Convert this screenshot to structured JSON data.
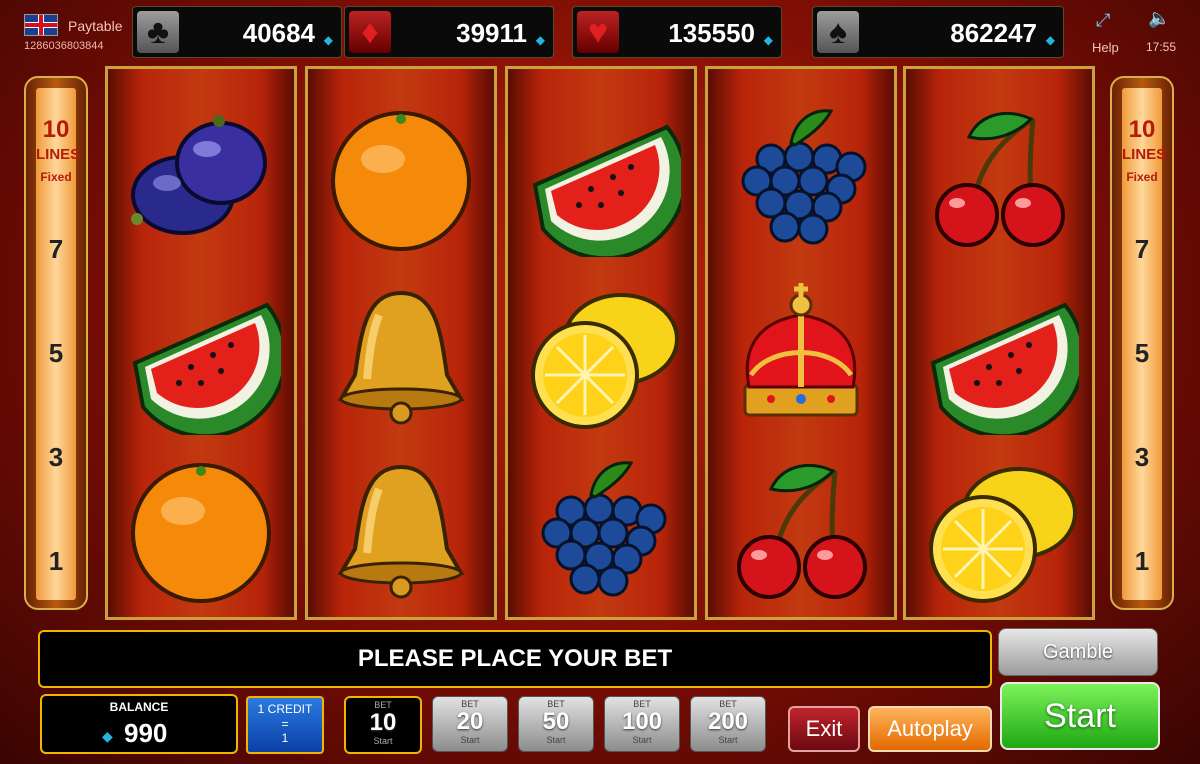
{
  "header": {
    "paytable_label": "Paytable",
    "ticket_id": "1286036803844",
    "help_label": "Help",
    "clock": "17:55",
    "flag_icon": "uk-flag-icon",
    "fullscreen_icon": "fullscreen-icon",
    "sound_icon": "speaker-icon"
  },
  "jackpots": [
    {
      "suit": "clubs",
      "symbol": "♣",
      "value": "40684"
    },
    {
      "suit": "diamonds",
      "symbol": "♦",
      "value": "39911"
    },
    {
      "suit": "hearts",
      "symbol": "♥",
      "value": "135550"
    },
    {
      "suit": "spades",
      "symbol": "♠",
      "value": "862247"
    }
  ],
  "lines_panel": {
    "count": "10",
    "word": "LINES",
    "fixed": "Fixed",
    "markers": [
      "7",
      "5",
      "3",
      "1"
    ]
  },
  "reels": [
    [
      "plum",
      "watermelon",
      "orange"
    ],
    [
      "orange",
      "bell",
      "bell"
    ],
    [
      "watermelon",
      "lemon",
      "grapes"
    ],
    [
      "grapes",
      "crown",
      "cherries"
    ],
    [
      "cherries",
      "watermelon",
      "lemon"
    ]
  ],
  "message": "PLEASE PLACE YOUR BET",
  "balance": {
    "label": "BALANCE",
    "value": "990"
  },
  "credit": {
    "title": "1 CREDIT",
    "eq": "=",
    "value": "1"
  },
  "bets": [
    {
      "label": "BET",
      "value": "10",
      "sub": "Start",
      "selected": true
    },
    {
      "label": "BET",
      "value": "20",
      "sub": "Start",
      "selected": false
    },
    {
      "label": "BET",
      "value": "50",
      "sub": "Start",
      "selected": false
    },
    {
      "label": "BET",
      "value": "100",
      "sub": "Start",
      "selected": false
    },
    {
      "label": "BET",
      "value": "200",
      "sub": "Start",
      "selected": false
    }
  ],
  "buttons": {
    "exit": "Exit",
    "autoplay": "Autoplay",
    "gamble": "Gamble",
    "start": "Start"
  },
  "colors": {
    "accent": "#f2b400",
    "start_green": "#1ea813",
    "frame_gold": "#c8a23a"
  }
}
